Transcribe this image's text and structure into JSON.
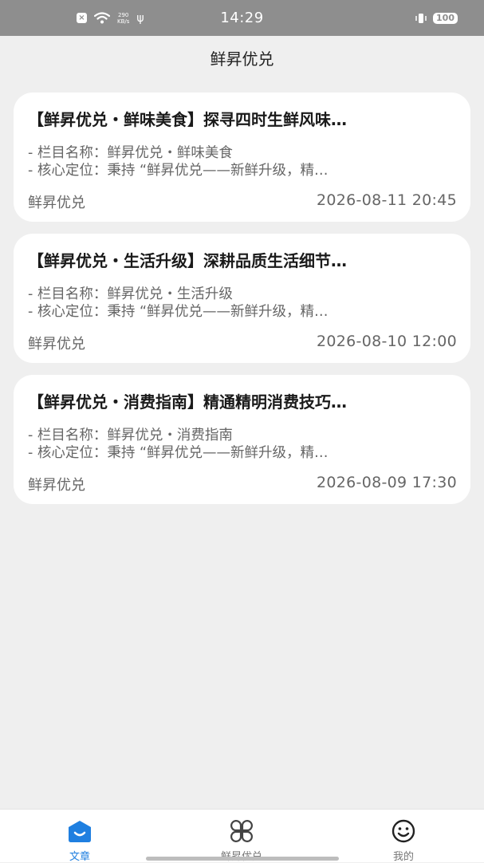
{
  "status_bar": {
    "network_speed_value": "290",
    "network_speed_unit": "KB/s",
    "time": "14:29",
    "battery": "100"
  },
  "header": {
    "title": "鲜昇优兑"
  },
  "articles": [
    {
      "title": "【鲜昇优兑・鲜味美食】探寻四时生鲜风味…",
      "line1": "- 栏目名称：鲜昇优兑・鲜味美食",
      "line2": "- 核心定位：秉持 “鲜昇优兑——新鲜升级，精…",
      "source": "鲜昇优兑",
      "time": "2026-08-11 20:45"
    },
    {
      "title": "【鲜昇优兑・生活升级】深耕品质生活细节…",
      "line1": "- 栏目名称：鲜昇优兑・生活升级",
      "line2": "- 核心定位：秉持 “鲜昇优兑——新鲜升级，精…",
      "source": "鲜昇优兑",
      "time": "2026-08-10 12:00"
    },
    {
      "title": "【鲜昇优兑・消费指南】精通精明消费技巧…",
      "line1": "- 栏目名称：鲜昇优兑・消费指南",
      "line2": "- 核心定位：秉持 “鲜昇优兑——新鲜升级，精…",
      "source": "鲜昇优兑",
      "time": "2026-08-09 17:30"
    }
  ],
  "tabs": [
    {
      "label": "文章",
      "icon": "home-icon",
      "active": true
    },
    {
      "label": "鲜昇优兑",
      "icon": "clover-grid-icon",
      "active": false
    },
    {
      "label": "我的",
      "icon": "smiley-icon",
      "active": false
    }
  ],
  "colors": {
    "accent": "#1f7fe0",
    "status_bar": "#8e8e8e",
    "background": "#efefef"
  }
}
